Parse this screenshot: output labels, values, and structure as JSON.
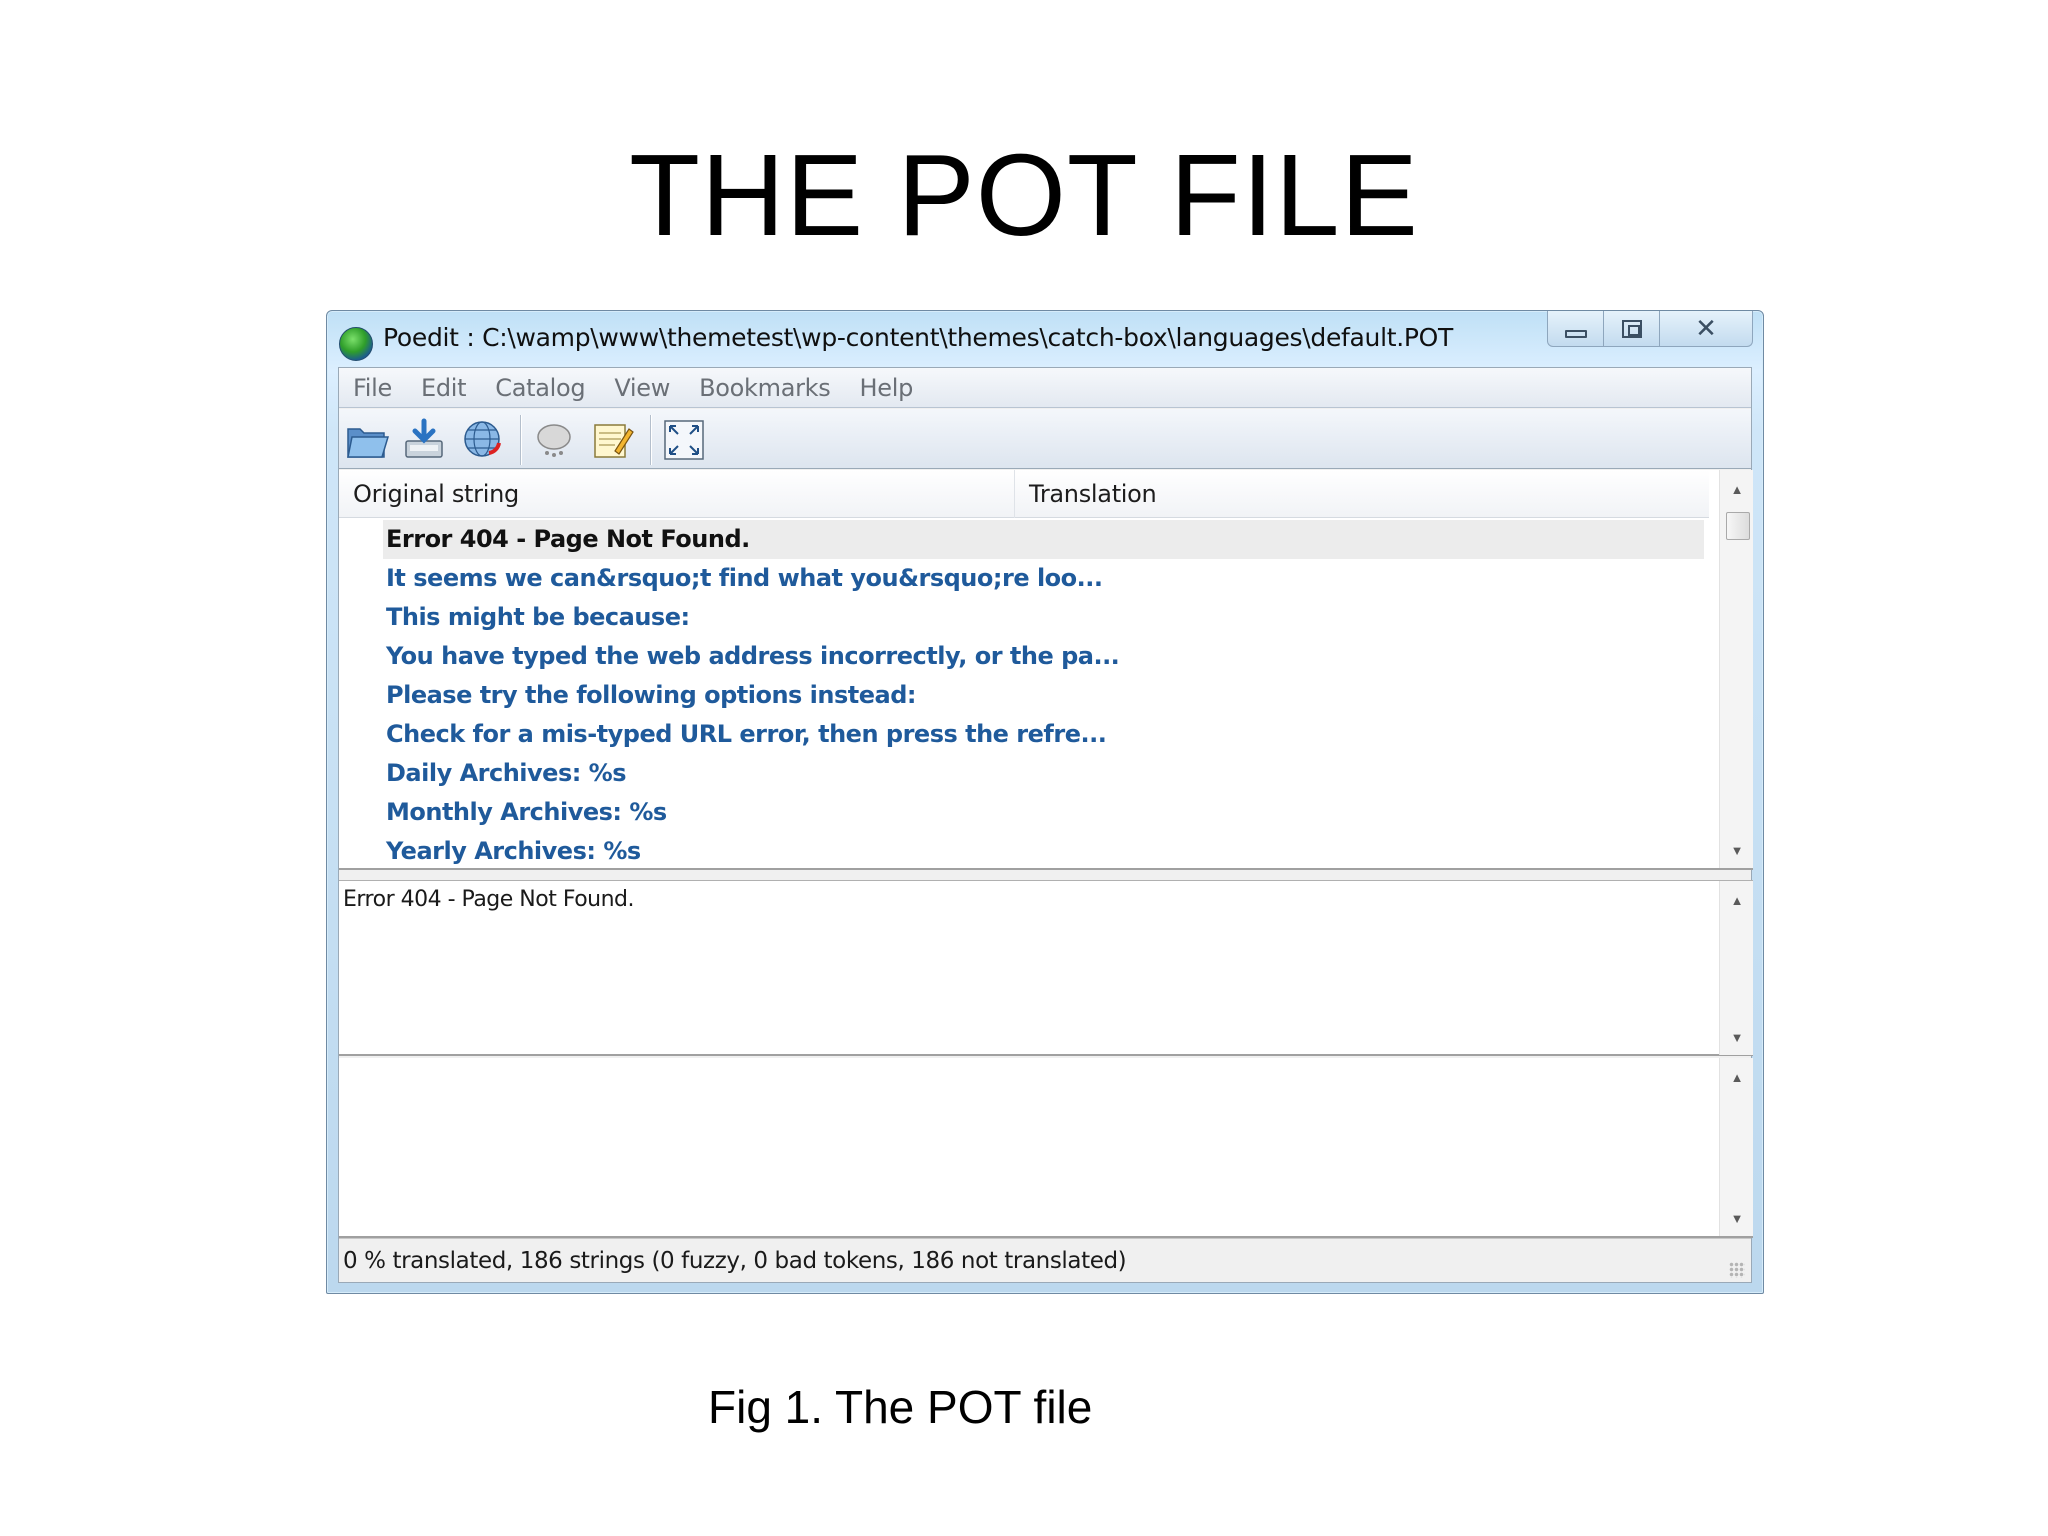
{
  "slide": {
    "title": "THE POT FILE",
    "caption": "Fig 1. The POT file"
  },
  "window": {
    "title": "Poedit : C:\\wamp\\www\\themetest\\wp-content\\themes\\catch-box\\languages\\default.POT"
  },
  "menu": {
    "items": [
      "File",
      "Edit",
      "Catalog",
      "View",
      "Bookmarks",
      "Help"
    ]
  },
  "toolbar": {
    "icons": [
      "open-folder-icon",
      "save-icon",
      "update-from-sources-icon",
      "validate-icon",
      "edit-comment-icon",
      "fullscreen-icon"
    ]
  },
  "list": {
    "columns": {
      "original": "Original string",
      "translation": "Translation"
    },
    "rows": [
      "Error 404 - Page Not Found.",
      "It seems we can&rsquo;t find what you&rsquo;re loo...",
      "This might be because:",
      "You have typed the web address incorrectly, or the pa...",
      "Please try the following options instead:",
      "Check for a mis-typed URL error, then press the refre...",
      "Daily Archives: %s",
      "Monthly Archives: %s",
      "Yearly Archives: %s"
    ],
    "selected_index": 0
  },
  "source_pane": {
    "text": "Error 404 - Page Not Found."
  },
  "translation_pane": {
    "text": ""
  },
  "status": {
    "text": "0 % translated, 186 strings (0 fuzzy, 0 bad tokens, 186 not translated)"
  },
  "colors": {
    "untranslated_row": "#1f5a9b",
    "selected_row_bg": "#ececec",
    "titlebar": "#cfe6f8"
  }
}
